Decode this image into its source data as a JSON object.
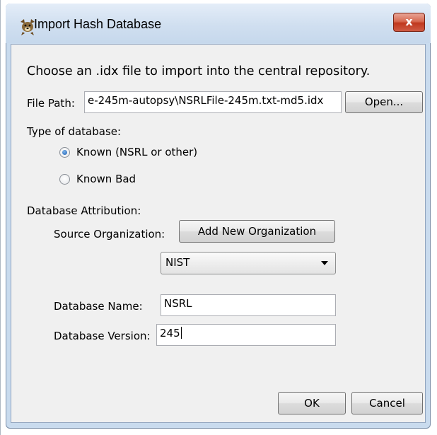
{
  "window": {
    "title": "Import Hash Database",
    "close_label": "x",
    "app_icon": "autopsy-dog-icon"
  },
  "instructions": "Choose an .idx file to import into the central repository.",
  "file_path": {
    "label": "File Path:",
    "value": "e-245m-autopsy\\NSRLFile-245m.txt-md5.idx",
    "open_button": "Open..."
  },
  "database_type": {
    "label": "Type of database:",
    "options": [
      {
        "label": "Known (NSRL or other)",
        "selected": true
      },
      {
        "label": "Known Bad",
        "selected": false
      }
    ]
  },
  "attribution": {
    "label": "Database Attribution:",
    "source_org_label": "Source Organization:",
    "add_org_button": "Add New Organization",
    "org_selected": "NIST"
  },
  "db_name": {
    "label": "Database Name:",
    "value": "NSRL"
  },
  "db_version": {
    "label": "Database Version:",
    "value": "245"
  },
  "buttons": {
    "ok": "OK",
    "cancel": "Cancel"
  },
  "colors": {
    "frame": "#c9dbee",
    "close_button": "#c0391f",
    "radio_selected": "#1a5fb4"
  }
}
